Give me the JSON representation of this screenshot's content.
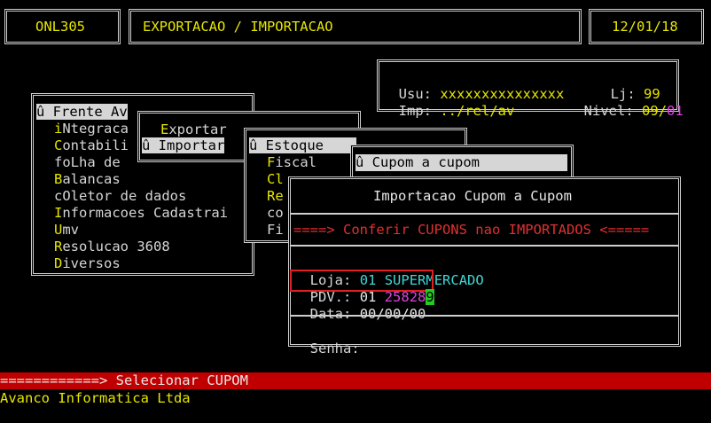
{
  "header": {
    "program_code": "ONL305",
    "screen_title": "EXPORTACAO / IMPORTACAO",
    "date": "12/01/18"
  },
  "user_panel": {
    "usu_label": "Usu:",
    "usu_value": "xxxxxxxxxxxxxxx",
    "lj_label": "Lj:",
    "lj_value": "99",
    "imp_label": "Imp:",
    "imp_value": "../rel/av",
    "nivel_label": "Nivel:",
    "nivel_value_a": "09",
    "nivel_sep": "/",
    "nivel_value_b": "01"
  },
  "main_menu": {
    "items": [
      {
        "hot": "û",
        "rest": " Frente Av"
      },
      {
        "hot": "i",
        "rest": "Ntegraca"
      },
      {
        "hot": "C",
        "rest": "ontabili"
      },
      {
        "hot": "fo",
        "rest": "Lha de"
      },
      {
        "hot": "B",
        "rest": "alancas"
      },
      {
        "hot": "c",
        "rest": "Oletor de dados"
      },
      {
        "hot": "I",
        "rest": "nformacoes Cadastrai"
      },
      {
        "hot": "U",
        "rest": "mv"
      },
      {
        "hot": "R",
        "rest": "esolucao 3608"
      },
      {
        "hot": "D",
        "rest": "iversos"
      }
    ]
  },
  "sub_menu_1": {
    "items": [
      {
        "hot": "E",
        "rest": "xportar"
      },
      {
        "hot": "û",
        "rest": " Importar"
      }
    ]
  },
  "sub_menu_2": {
    "items": [
      {
        "hot": "û",
        "rest": " Estoque"
      },
      {
        "hot": "F",
        "rest": "iscal"
      },
      {
        "hot": "Cl",
        "rest": ""
      },
      {
        "hot": "Re",
        "rest": ""
      },
      {
        "hot": "co",
        "rest": ""
      },
      {
        "hot": "Fi",
        "rest": ""
      }
    ]
  },
  "sub_menu_3": {
    "item": "û Cupom a cupom"
  },
  "dialog": {
    "title": "Importacao Cupom a Cupom",
    "warning": "====> Conferir CUPONS nao IMPORTADOS <=====",
    "loja_label": "Loja:",
    "loja_code": "01",
    "loja_name": "SUPERMERCADO",
    "pdv_label": "PDV.:",
    "pdv_code": "01",
    "pdv_number": "25828",
    "pdv_cursor": "9",
    "data_label": "Data:",
    "data_value": "00/00/00",
    "senha_label": "Senha:"
  },
  "status_bar": {
    "message": "============> Selecionar CUPOM"
  },
  "footer": {
    "company": "Avanco Informatica Ltda"
  },
  "colors": {
    "background": "#000000",
    "highlight_yellow": "#e6e600",
    "cyan": "#3fd6d6",
    "magenta": "#e040e0",
    "status_red": "#c00000",
    "cursor_green": "#22cc22"
  }
}
